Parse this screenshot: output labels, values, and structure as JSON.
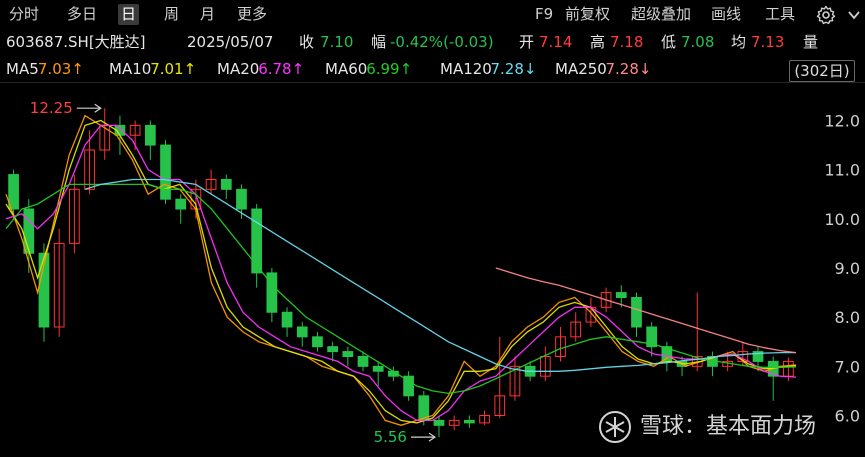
{
  "toolbar": {
    "left_tabs": [
      {
        "label": "分时",
        "active": false
      },
      {
        "label": "多日",
        "active": false
      },
      {
        "label": "日",
        "active": true
      },
      {
        "label": "周",
        "active": false
      },
      {
        "label": "月",
        "active": false
      },
      {
        "label": "更多",
        "active": false
      }
    ],
    "right_items": [
      "F9",
      "前复权",
      "超级叠加",
      "画线",
      "工具"
    ]
  },
  "stock": {
    "code_name": "603687.SH[大胜达]",
    "date": "2025/05/07",
    "close_label": "收",
    "close_value": "7.10",
    "change_label": "幅",
    "change_value": "-0.42%(-0.03)",
    "open_label": "开",
    "open_value": "7.14",
    "high_label": "高",
    "high_value": "7.18",
    "low_label": "低",
    "low_value": "7.08",
    "avg_label": "均",
    "avg_value": "7.13",
    "vol_label": "量"
  },
  "ma_legend": [
    {
      "name": "MA5",
      "value": "7.03↑",
      "color": "#ff9900"
    },
    {
      "name": "MA10",
      "value": "7.01↑",
      "color": "#e6e600"
    },
    {
      "name": "MA20",
      "value": "6.78↑",
      "color": "#ff33ff"
    },
    {
      "name": "MA60",
      "value": "6.99↑",
      "color": "#22cc22"
    },
    {
      "name": "MA120",
      "value": "7.28↓",
      "color": "#66ddee"
    },
    {
      "name": "MA250",
      "value": "7.28↓",
      "color": "#ff8888"
    }
  ],
  "days_box": "(302日)",
  "chart_data": {
    "type": "line",
    "y_axis_ticks": [
      "12.0",
      "11.0",
      "10.0",
      "9.0",
      "8.0",
      "7.0",
      "6.0"
    ],
    "ylim": [
      5.4,
      12.6
    ],
    "annotations": [
      {
        "text": "12.25",
        "value": 12.25,
        "kind": "high"
      },
      {
        "text": "5.56",
        "value": 5.56,
        "kind": "low"
      }
    ],
    "colors": {
      "up": "#ff3333",
      "down": "#26c24a",
      "flat": "#d8d8d8"
    },
    "series": [
      {
        "name": "MA5",
        "color": "#ff9900",
        "values": [
          10.5,
          9.6,
          8.5,
          9.9,
          11.3,
          12.1,
          11.9,
          11.7,
          11.2,
          10.5,
          10.7,
          10.6,
          10.2,
          8.7,
          8.0,
          7.7,
          7.5,
          7.4,
          7.3,
          7.2,
          7.0,
          6.9,
          6.8,
          6.4,
          5.9,
          5.8,
          5.9,
          6.0,
          6.4,
          7.1,
          6.8,
          7.0,
          7.5,
          7.8,
          8.0,
          8.3,
          8.4,
          8.1,
          7.7,
          7.3,
          7.1,
          7.0,
          7.2,
          7.0,
          7.1,
          7.2,
          7.3,
          7.0,
          6.9,
          7.0,
          7.03
        ]
      },
      {
        "name": "MA10",
        "color": "#e6e600",
        "values": [
          10.3,
          9.8,
          8.8,
          9.8,
          11.0,
          11.9,
          12.0,
          11.8,
          11.3,
          10.7,
          10.6,
          10.7,
          10.3,
          9.0,
          8.2,
          7.8,
          7.6,
          7.4,
          7.3,
          7.2,
          7.1,
          6.9,
          6.8,
          6.5,
          6.1,
          5.9,
          5.85,
          5.95,
          6.3,
          6.9,
          6.9,
          6.95,
          7.4,
          7.7,
          7.9,
          8.2,
          8.3,
          8.2,
          7.8,
          7.4,
          7.15,
          7.05,
          7.1,
          7.05,
          7.1,
          7.2,
          7.25,
          7.05,
          6.95,
          6.98,
          7.01
        ]
      },
      {
        "name": "MA20",
        "color": "#ff33ff",
        "values": [
          10.0,
          10.1,
          9.8,
          10.1,
          10.7,
          11.5,
          11.9,
          11.9,
          11.6,
          11.0,
          10.8,
          10.8,
          10.5,
          9.6,
          8.7,
          8.1,
          7.8,
          7.6,
          7.4,
          7.3,
          7.2,
          7.1,
          6.9,
          6.8,
          6.4,
          6.1,
          5.9,
          5.9,
          6.1,
          6.5,
          6.7,
          6.8,
          7.1,
          7.4,
          7.7,
          8.0,
          8.2,
          8.2,
          8.0,
          7.7,
          7.4,
          7.25,
          7.2,
          7.15,
          7.15,
          7.2,
          7.25,
          7.1,
          6.9,
          6.8,
          6.78
        ]
      },
      {
        "name": "MA60",
        "color": "#22cc22",
        "values": [
          9.8,
          10.2,
          10.3,
          10.5,
          10.7,
          10.7,
          10.7,
          10.7,
          10.7,
          10.7,
          10.6,
          10.6,
          10.5,
          10.2,
          9.8,
          9.4,
          9.0,
          8.6,
          8.3,
          8.0,
          7.8,
          7.6,
          7.4,
          7.2,
          7.0,
          6.8,
          6.6,
          6.5,
          6.45,
          6.5,
          6.6,
          6.75,
          6.9,
          7.05,
          7.2,
          7.35,
          7.45,
          7.55,
          7.6,
          7.55,
          7.5,
          7.45,
          7.35,
          7.25,
          7.15,
          7.1,
          7.05,
          7.0,
          6.98,
          6.98,
          6.99
        ]
      },
      {
        "name": "MA120",
        "color": "#66ddee",
        "values": [
          null,
          null,
          null,
          null,
          null,
          10.6,
          10.7,
          10.75,
          10.8,
          10.8,
          10.8,
          10.75,
          10.7,
          10.5,
          10.3,
          10.1,
          9.9,
          9.7,
          9.5,
          9.3,
          9.1,
          8.9,
          8.7,
          8.5,
          8.3,
          8.1,
          7.9,
          7.7,
          7.5,
          7.35,
          7.2,
          7.05,
          6.95,
          6.9,
          6.9,
          6.9,
          6.92,
          6.95,
          6.98,
          7.0,
          7.02,
          7.05,
          7.08,
          7.12,
          7.15,
          7.2,
          7.22,
          7.25,
          7.27,
          7.28,
          7.28
        ]
      },
      {
        "name": "MA250",
        "color": "#ff8888",
        "values": [
          null,
          null,
          null,
          null,
          null,
          null,
          null,
          null,
          null,
          null,
          null,
          null,
          null,
          null,
          null,
          null,
          null,
          null,
          null,
          null,
          null,
          null,
          null,
          null,
          null,
          null,
          null,
          null,
          null,
          null,
          null,
          9.0,
          8.9,
          8.8,
          8.72,
          8.65,
          8.55,
          8.45,
          8.35,
          8.25,
          8.15,
          8.05,
          7.95,
          7.85,
          7.75,
          7.65,
          7.55,
          7.45,
          7.38,
          7.32,
          7.28
        ]
      }
    ],
    "candles": [
      [
        10.9,
        10.2,
        11.0,
        10.0
      ],
      [
        10.2,
        9.3,
        10.4,
        8.9
      ],
      [
        9.3,
        7.8,
        9.5,
        7.5
      ],
      [
        7.8,
        9.5,
        9.8,
        7.6
      ],
      [
        9.5,
        10.6,
        10.9,
        9.3
      ],
      [
        10.6,
        11.4,
        11.8,
        10.5
      ],
      [
        11.4,
        11.9,
        12.25,
        11.2
      ],
      [
        11.9,
        11.7,
        12.1,
        11.3
      ],
      [
        11.7,
        11.9,
        12.0,
        11.4
      ],
      [
        11.9,
        11.5,
        12.0,
        11.2
      ],
      [
        11.5,
        10.4,
        11.6,
        10.3
      ],
      [
        10.4,
        10.2,
        10.5,
        9.9
      ],
      [
        10.2,
        10.6,
        10.8,
        10.0
      ],
      [
        10.6,
        10.8,
        11.0,
        10.5
      ],
      [
        10.8,
        10.6,
        10.9,
        10.4
      ],
      [
        10.6,
        10.2,
        10.7,
        10.0
      ],
      [
        10.2,
        8.9,
        10.3,
        8.6
      ],
      [
        8.9,
        8.1,
        9.0,
        7.9
      ],
      [
        8.1,
        7.8,
        8.2,
        7.6
      ],
      [
        7.8,
        7.6,
        7.9,
        7.4
      ],
      [
        7.6,
        7.4,
        7.7,
        7.3
      ],
      [
        7.4,
        7.3,
        7.5,
        7.1
      ],
      [
        7.3,
        7.2,
        7.4,
        7.0
      ],
      [
        7.2,
        7.0,
        7.3,
        6.9
      ],
      [
        7.0,
        6.9,
        7.1,
        6.6
      ],
      [
        6.9,
        6.8,
        7.0,
        6.7
      ],
      [
        6.8,
        6.4,
        6.9,
        6.3
      ],
      [
        6.4,
        5.9,
        6.5,
        5.8
      ],
      [
        5.9,
        5.8,
        6.0,
        5.56
      ],
      [
        5.8,
        5.9,
        6.0,
        5.7
      ],
      [
        5.9,
        5.85,
        6.0,
        5.75
      ],
      [
        5.85,
        6.0,
        6.1,
        5.8
      ],
      [
        6.0,
        6.4,
        7.6,
        5.95
      ],
      [
        6.4,
        7.0,
        7.2,
        6.3
      ],
      [
        7.0,
        6.8,
        7.1,
        6.7
      ],
      [
        6.8,
        7.2,
        7.4,
        6.7
      ],
      [
        7.2,
        7.6,
        7.8,
        7.1
      ],
      [
        7.6,
        7.9,
        8.1,
        7.5
      ],
      [
        7.9,
        8.2,
        8.4,
        7.8
      ],
      [
        8.2,
        8.5,
        8.6,
        8.1
      ],
      [
        8.5,
        8.4,
        8.65,
        8.2
      ],
      [
        8.4,
        7.8,
        8.5,
        7.6
      ],
      [
        7.8,
        7.4,
        7.9,
        7.2
      ],
      [
        7.4,
        7.1,
        7.5,
        6.9
      ],
      [
        7.1,
        7.0,
        7.2,
        6.8
      ],
      [
        7.0,
        7.2,
        8.5,
        6.9
      ],
      [
        7.2,
        7.0,
        7.3,
        6.8
      ],
      [
        7.0,
        7.1,
        7.3,
        6.9
      ],
      [
        7.1,
        7.3,
        7.5,
        7.0
      ],
      [
        7.3,
        7.1,
        7.4,
        6.9
      ],
      [
        7.1,
        6.8,
        7.2,
        6.3
      ],
      [
        6.8,
        7.1,
        7.18,
        6.7
      ]
    ]
  },
  "watermark": {
    "text": "雪球：基本面力场"
  }
}
